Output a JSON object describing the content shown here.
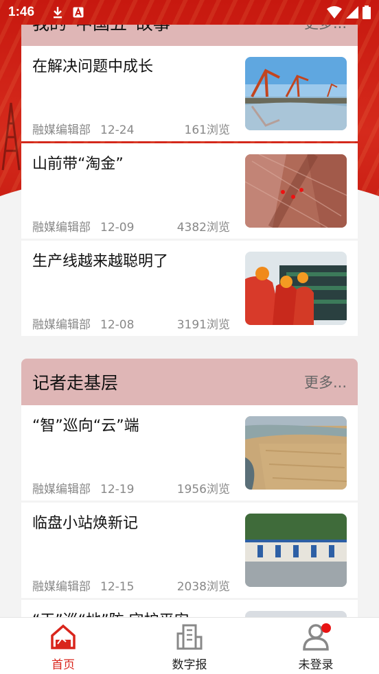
{
  "status_bar": {
    "time": "1:46",
    "icons": [
      "download-icon",
      "app-notification-icon",
      "wifi-icon",
      "signal-icon",
      "battery-icon"
    ]
  },
  "sections": [
    {
      "title": "我的“中国五”故事",
      "more": "更多...",
      "articles": [
        {
          "title": "在解决问题中成长",
          "source": "融媒编辑部",
          "date": "12-24",
          "views": "161浏览",
          "image": "oil-pumpjacks-photo"
        },
        {
          "title": "山前带“淘金”",
          "source": "融媒编辑部",
          "date": "12-09",
          "views": "4382浏览",
          "image": "red-rock-ravine-photo"
        },
        {
          "title": "生产线越来越聪明了",
          "source": "融媒编辑部",
          "date": "12-08",
          "views": "3191浏览",
          "image": "workers-pipes-photo"
        }
      ]
    },
    {
      "title": "记者走基层",
      "more": "更多...",
      "articles": [
        {
          "title": "“智”巡向“云”端",
          "source": "融媒编辑部",
          "date": "12-19",
          "views": "1956浏览",
          "image": "reed-marsh-photo"
        },
        {
          "title": "临盘小站焕新记",
          "source": "融媒编辑部",
          "date": "12-15",
          "views": "2038浏览",
          "image": "station-building-photo"
        },
        {
          "title": "“天”巡“地”防 守护平安",
          "source": "",
          "date": "",
          "views": "",
          "image": "sky-photo"
        }
      ]
    }
  ],
  "bottom_nav": [
    {
      "label": "首页",
      "icon": "home-icon",
      "active": true
    },
    {
      "label": "数字报",
      "icon": "building-icon",
      "active": false
    },
    {
      "label": "未登录",
      "icon": "user-icon",
      "active": false,
      "badge": true
    }
  ],
  "colors": {
    "brand_red": "#d9251c",
    "section_header_bg": "#dfb6b6",
    "hero_red": "#c7180f"
  }
}
